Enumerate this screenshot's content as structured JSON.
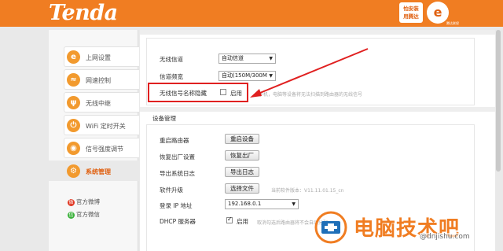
{
  "header": {
    "logo": "Tenda",
    "badge_line1": "怕安装",
    "badge_line2": "用腾达",
    "badge2_glyph": "e",
    "badge2_sub": "腾达联保"
  },
  "sidebar": {
    "items": [
      {
        "label": "上网设置",
        "icon": "e"
      },
      {
        "label": "网速控制",
        "icon": "≈"
      },
      {
        "label": "无线中继",
        "icon": "ψ"
      },
      {
        "label": "WiFi 定时开关",
        "icon": "⏻"
      },
      {
        "label": "信号强度调节",
        "icon": "◉"
      },
      {
        "label": "系统管理",
        "icon": "⚙"
      }
    ],
    "links": [
      {
        "label": "官方微博",
        "icon": "微",
        "color": "#e0341f"
      },
      {
        "label": "官方微信",
        "icon": "信",
        "color": "#3bb13b"
      }
    ]
  },
  "wireless": {
    "channel_label": "无线信道",
    "channel_value": "自动信道",
    "bandwidth_label": "信道频宽",
    "bandwidth_value": "自动(150M/300M",
    "hide_ssid_label": "无线信号名称隐藏",
    "hide_ssid_option": "启用",
    "hide_ssid_hint": "…手机，电脑等设备将无法扫描到路由器的无线信号"
  },
  "device": {
    "title": "设备管理",
    "reboot_label": "重启路由器",
    "reboot_button": "重启设备",
    "restore_label": "恢复出厂设置",
    "restore_button": "恢复出厂",
    "export_label": "导出系统日志",
    "export_button": "导出日志",
    "upgrade_label": "软件升级",
    "upgrade_button": "选择文件",
    "upgrade_hint": "当前软件版本：V11.11.01.15_cn",
    "login_ip_label": "登录 IP 地址",
    "login_ip_value": "192.168.0.1",
    "dhcp_label": "DHCP 服务器",
    "dhcp_option": "启用",
    "dhcp_hint": "取消勾选后路由器将不会自动分配"
  },
  "watermark": {
    "text": "电脑技术吧",
    "sub": "@dnjishu.com"
  },
  "colors": {
    "brand": "#f07d22",
    "highlight": "#e02020"
  }
}
